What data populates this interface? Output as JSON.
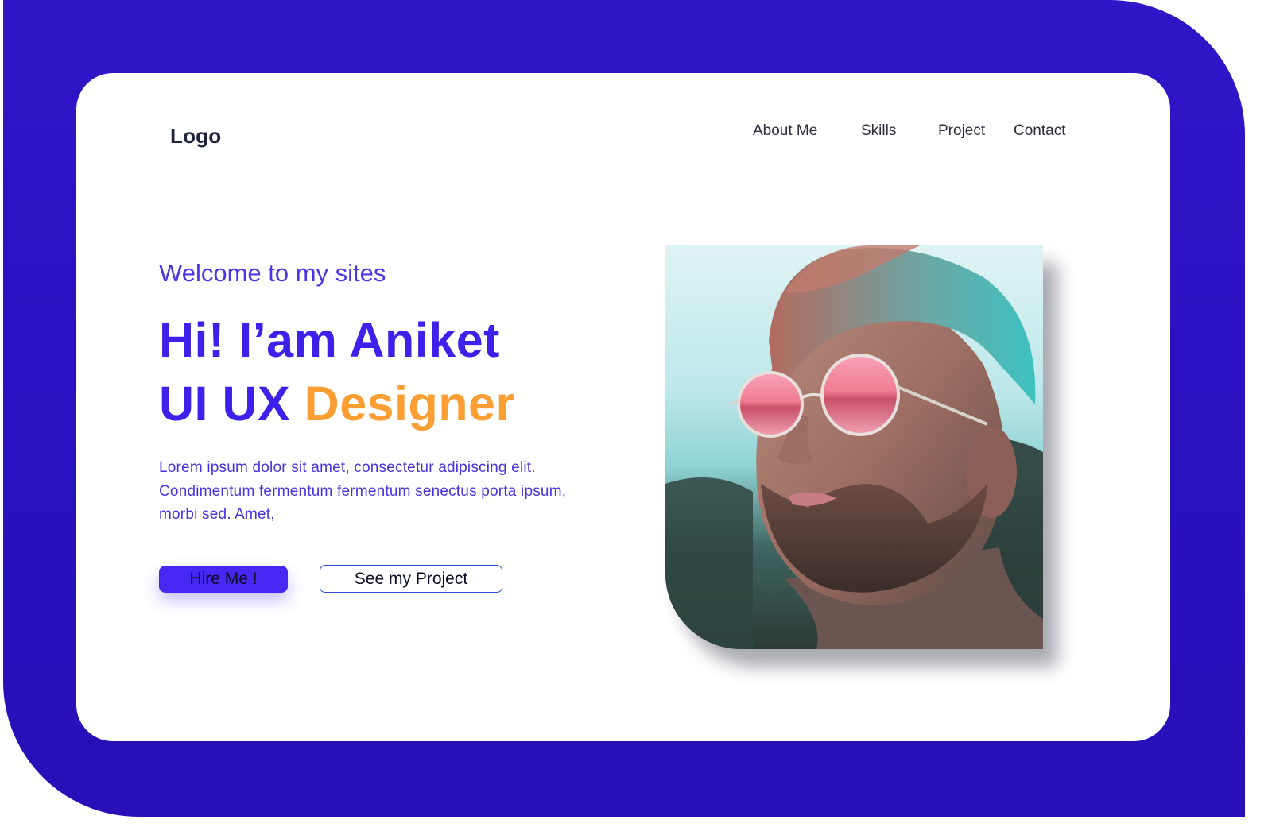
{
  "header": {
    "logo": "Logo",
    "nav": [
      "About Me",
      "Skills",
      "Project",
      "Contact"
    ]
  },
  "hero": {
    "welcome": "Welcome to my sites",
    "headline_line1": "Hi! I’am Aniket",
    "headline_line2_prefix": "UI UX",
    "headline_line2_accent": "Designer",
    "description": "Lorem ipsum dolor sit amet, consectetur adipiscing elit. Condimentum fermentum fermentum senectus porta ipsum, morbi sed. Amet,",
    "primary_button": "Hire Me !",
    "secondary_button": "See my Project"
  },
  "colors": {
    "frame": "#2a12c4",
    "primary": "#3d20ea",
    "accent": "#fb9e34",
    "text_dark": "#1f2340"
  },
  "icons": {
    "portrait": "man-with-pink-sunglasses-photo"
  }
}
